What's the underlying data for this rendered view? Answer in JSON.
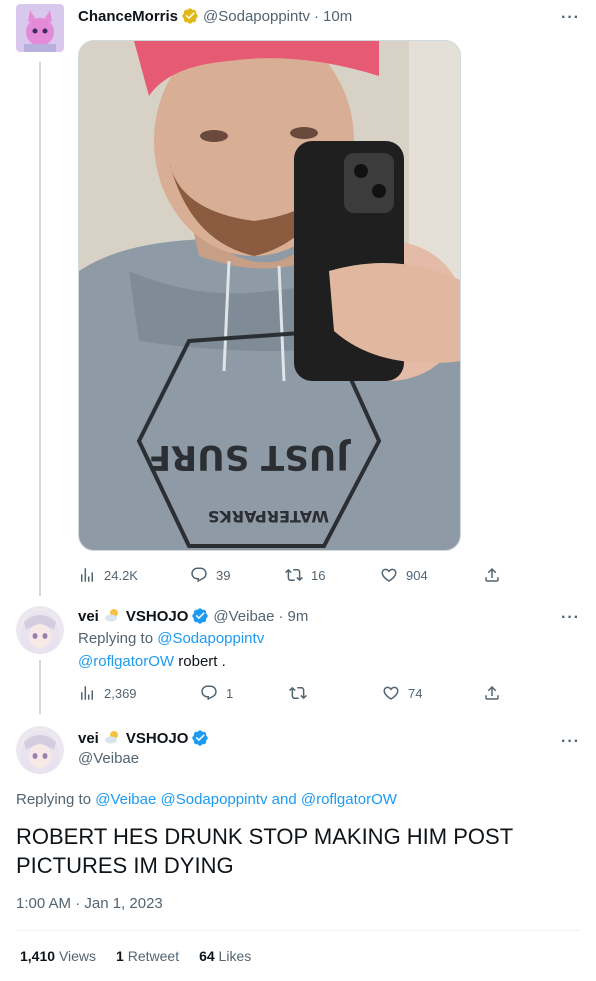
{
  "tweet1": {
    "display_name": "ChanceMorris",
    "handle": "@Sodapoppintv",
    "time": "10m",
    "photo_texts": [
      "JUST SURF",
      "WATERPARKS"
    ],
    "stats": {
      "views": "24.2K",
      "replies": "39",
      "retweets": "16",
      "likes": "904"
    }
  },
  "tweet2": {
    "display_name": "vei",
    "org": "VSHOJO",
    "handle": "@Veibae",
    "time": "9m",
    "replying_to_prefix": "Replying to",
    "replying_to_handle": "@Sodapoppintv",
    "body_mention": "@roflgatorOW",
    "body_text": " robert .",
    "stats": {
      "views": "2,369",
      "replies": "1",
      "retweets": "",
      "likes": "74"
    }
  },
  "main_tweet": {
    "display_name": "vei",
    "org": "VSHOJO",
    "handle": "@Veibae",
    "replying_to_prefix": "Replying to",
    "replying_to_handles": "@Veibae @Sodapoppintv",
    "replying_to_and": "and",
    "replying_to_last": "@roflgatorOW",
    "text": "ROBERT HES DRUNK STOP MAKING HIM POST PICTURES IM DYING",
    "timestamp": "1:00 AM · Jan 1, 2023",
    "views_count": "1,410",
    "views_label": "Views",
    "retweets_count": "1",
    "retweets_label": "Retweet",
    "likes_count": "64",
    "likes_label": "Likes"
  },
  "colors": {
    "link": "#1d9bf0",
    "secondary_text": "#536471",
    "gold_badge": "#e2b719",
    "blue_badge": "#1d9bf0",
    "thread_line": "#cfd9de"
  }
}
